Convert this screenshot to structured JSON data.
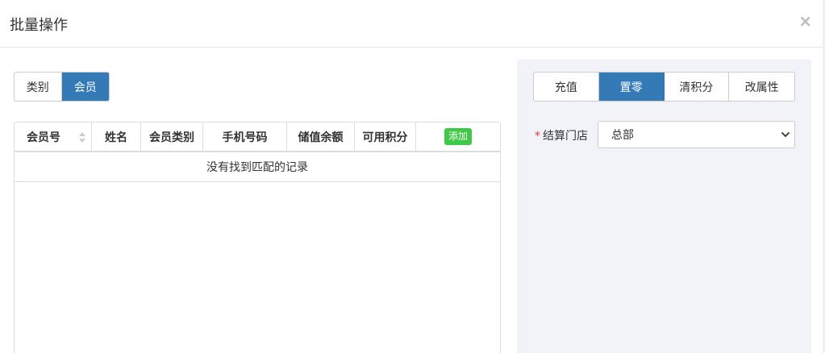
{
  "modal": {
    "title": "批量操作",
    "close_label": "×"
  },
  "left_tabs": [
    {
      "label": "类别",
      "active": false
    },
    {
      "label": "会员",
      "active": true
    }
  ],
  "table": {
    "columns": [
      "会员号",
      "姓名",
      "会员类别",
      "手机号码",
      "储值余额",
      "可用积分"
    ],
    "add_label": "添加",
    "empty_text": "没有找到匹配的记录"
  },
  "right_tabs": [
    {
      "label": "充值",
      "active": false
    },
    {
      "label": "置零",
      "active": true
    },
    {
      "label": "清积分",
      "active": false
    },
    {
      "label": "改属性",
      "active": false
    }
  ],
  "store_field": {
    "required_mark": "*",
    "label": "结算门店",
    "value": "总部"
  },
  "colors": {
    "accent": "#337ab7",
    "add_button": "#3ec846",
    "panel_bg": "#f2f3f8",
    "required": "#e4393c"
  }
}
